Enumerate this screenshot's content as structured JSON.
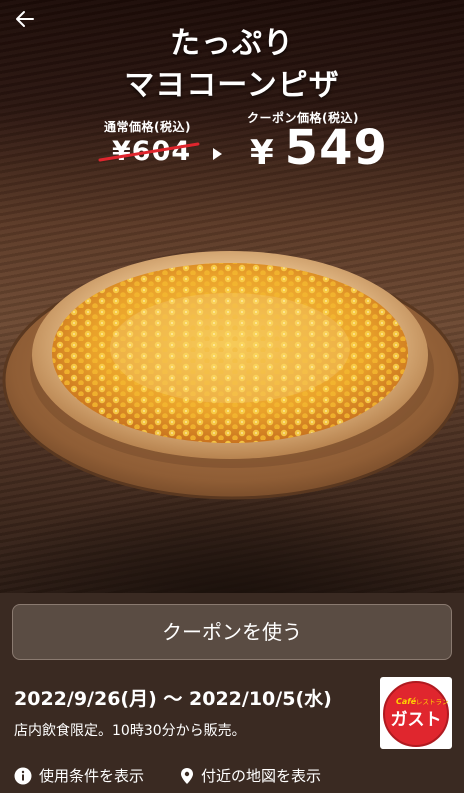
{
  "header": {
    "back_icon": "arrow-left-icon",
    "title_line1": "たっぷり",
    "title_line2": "マヨコーンピザ"
  },
  "pricing": {
    "regular_label": "通常価格(税込)",
    "regular_price": "¥604",
    "coupon_label": "クーポン価格(税込)",
    "coupon_currency": "¥",
    "coupon_price": "549",
    "strike_color": "#e0262e"
  },
  "actions": {
    "use_coupon_label": "クーポンを使う"
  },
  "details": {
    "date_range": "2022/9/26(月) 〜 2022/10/5(水)",
    "note": "店内飲食限定。10時30分から販売。"
  },
  "brand": {
    "logo_prefix": "Café",
    "logo_small": "レストラン",
    "logo_name": "ガスト",
    "logo_color": "#e0262e"
  },
  "links": {
    "terms_icon": "info-icon",
    "terms_label": "使用条件を表示",
    "map_icon": "location-pin-icon",
    "map_label": "付近の地図を表示"
  }
}
